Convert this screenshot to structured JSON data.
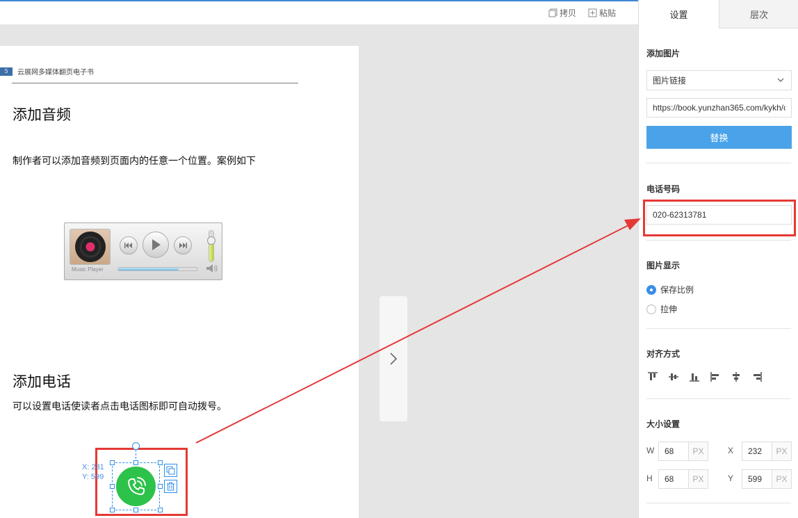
{
  "toolbar": {
    "copy_label": "拷贝",
    "paste_label": "粘贴"
  },
  "page": {
    "page_number": "5",
    "header_text": "云展网多媒体翻页电子书",
    "audio_title": "添加音频",
    "audio_desc": "制作者可以添加音频到页面内的任意一个位置。案例如下",
    "player_label": "Music Player",
    "player_progress": 0.76,
    "player_volume": 0.75,
    "phone_title": "添加电话",
    "phone_desc": "可以设置电话使读者点击电话图标即可自动拨号。",
    "selection_x_label": "X: 231",
    "selection_y_label": "Y: 599"
  },
  "panel": {
    "tabs": [
      {
        "label": "设置",
        "active": true
      },
      {
        "label": "层次",
        "active": false
      }
    ],
    "add_image_label": "添加图片",
    "image_source_select": "图片链接",
    "image_url_value": "https://book.yunzhan365.com/kykh/c",
    "replace_button": "替换",
    "phone_label": "电话号码",
    "phone_value": "020-62313781",
    "display_label": "图片显示",
    "display_options": [
      {
        "label": "保存比例",
        "selected": true
      },
      {
        "label": "拉伸",
        "selected": false
      }
    ],
    "align_label": "对齐方式",
    "size_label": "大小设置",
    "size": {
      "w_label": "W",
      "w_value": "68",
      "h_label": "H",
      "h_value": "68",
      "x_label": "X",
      "x_value": "232",
      "y_label": "Y",
      "y_value": "599",
      "unit": "PX"
    }
  },
  "colors": {
    "accent": "#4aa3e9",
    "selection": "#2a8ee8",
    "highlight": "#e53935",
    "phone_green": "#2dc24a"
  }
}
